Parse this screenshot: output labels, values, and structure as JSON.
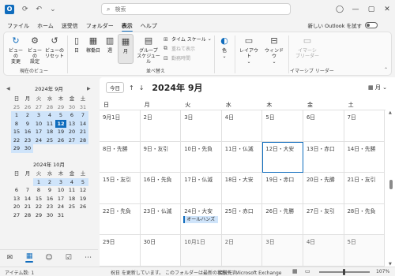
{
  "titlebar": {
    "search_placeholder": "検索"
  },
  "menu": {
    "items": [
      "ファイル",
      "ホーム",
      "送受信",
      "フォルダー",
      "表示",
      "ヘルプ"
    ],
    "active_index": 4,
    "new_outlook_label": "新しい Outlook を試す"
  },
  "ribbon": {
    "change_view": "ビューの\n変更",
    "view_settings": "ビューの\n設定",
    "reset_view": "ビューの\nリセット",
    "current_view_group": "現在のビュー",
    "day": "日",
    "work_week": "稼働日",
    "week": "週",
    "month": "月",
    "group_schedule": "グループ\nスケジュール",
    "time_scale": "タイム スケール",
    "overlay": "重ねて表示",
    "working_hours": "勤務時間",
    "arrange_group": "並べ替え",
    "color": "色",
    "layout": "レイアウト",
    "window": "ウィンドウ",
    "immersive_reader": "イマーシ\nブリーダー",
    "immersive_group": "イマーシブ リーダー"
  },
  "mini_calendars": [
    {
      "title": "2024年 9月",
      "dow": [
        "日",
        "月",
        "火",
        "水",
        "木",
        "金",
        "土"
      ],
      "days": [
        [
          "25",
          "26",
          "27",
          "28",
          "29",
          "30",
          "31"
        ],
        [
          "1",
          "2",
          "3",
          "4",
          "5",
          "6",
          "7"
        ],
        [
          "8",
          "9",
          "10",
          "11",
          "12",
          "13",
          "14"
        ],
        [
          "15",
          "16",
          "17",
          "18",
          "19",
          "20",
          "21"
        ],
        [
          "22",
          "23",
          "24",
          "25",
          "26",
          "27",
          "28"
        ],
        [
          "29",
          "30",
          "",
          "",
          "",
          "",
          ""
        ]
      ]
    },
    {
      "title": "2024年 10月",
      "dow": [
        "日",
        "月",
        "火",
        "水",
        "木",
        "金",
        "土"
      ],
      "days": [
        [
          "",
          "",
          "1",
          "2",
          "3",
          "4",
          "5"
        ],
        [
          "6",
          "7",
          "8",
          "9",
          "10",
          "11",
          "12"
        ],
        [
          "13",
          "14",
          "15",
          "16",
          "17",
          "18",
          "19"
        ],
        [
          "20",
          "21",
          "22",
          "23",
          "24",
          "25",
          "26"
        ],
        [
          "27",
          "28",
          "29",
          "30",
          "31",
          "",
          ""
        ]
      ]
    }
  ],
  "calendar": {
    "today_button": "今日",
    "title": "2024年 9月",
    "view_selector": "月",
    "dow": [
      "日",
      "月",
      "火",
      "水",
      "木",
      "金",
      "土"
    ],
    "weeks": [
      [
        "9月1日",
        "2日",
        "3日",
        "4日",
        "5日",
        "6日",
        "7日"
      ],
      [
        "8日・先勝",
        "9日・友引",
        "10日・先負",
        "11日・仏滅",
        "12日・大安",
        "13日・赤口",
        "14日・先勝"
      ],
      [
        "15日・友引",
        "16日・先負",
        "17日・仏滅",
        "18日・大安",
        "19日・赤口",
        "20日・先勝",
        "21日・友引"
      ],
      [
        "22日・先負",
        "23日・仏滅",
        "24日・大安",
        "25日・赤口",
        "26日・先勝",
        "27日・友引",
        "28日・先負"
      ],
      [
        "29日",
        "30日",
        "10月1日",
        "2日",
        "3日",
        "4日",
        "5日"
      ]
    ],
    "event_label": "オールハンズ"
  },
  "statusbar": {
    "items_count": "アイテム数: 1",
    "message": "祝日 を更新しています。 このフォルダーは最新の状態です。",
    "connection": "接続先: Microsoft Exchange",
    "zoom": "107%"
  },
  "colors": {
    "accent": "#0f6cbd",
    "highlight": "#cfe4fa"
  }
}
